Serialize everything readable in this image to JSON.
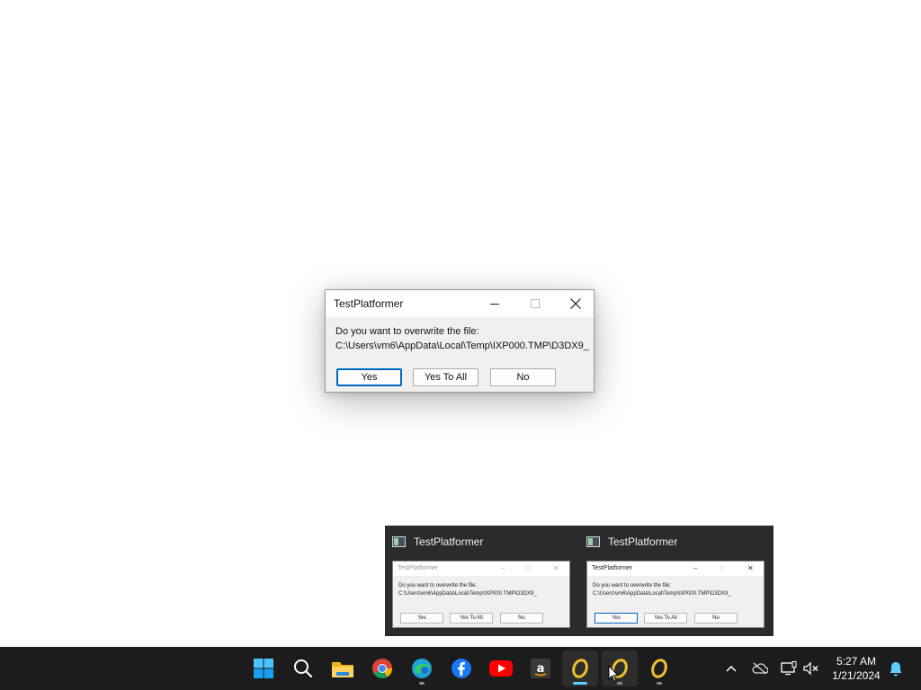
{
  "dialog": {
    "title": "TestPlatformer",
    "message_line1": "Do you want to overwrite the file:",
    "message_line2": "C:\\Users\\vm6\\AppData\\Local\\Temp\\IXP000.TMP\\D3DX9_",
    "buttons": {
      "yes": "Yes",
      "yes_to_all": "Yes To All",
      "no": "No"
    },
    "default_button": "yes"
  },
  "thumbnails": [
    {
      "title": "TestPlatformer",
      "dialog_title": "TestPlatformer",
      "message_line1": "Do you want to overwrite the file:",
      "message_line2": "C:\\Users\\vm6\\AppData\\Local\\Temp\\IXP000.TMP\\D3DX9_",
      "buttons": [
        "Yes",
        "Yes To All",
        "No"
      ]
    },
    {
      "title": "TestPlatformer",
      "dialog_title": "TestPlatformer",
      "message_line1": "Do you want to overwrite the file:",
      "message_line2": "C:\\Users\\vm6\\AppData\\Local\\Temp\\IXP000.TMP\\D3DX9_",
      "buttons": [
        "Yes",
        "Yes To All",
        "No"
      ]
    }
  ],
  "taskbar": {
    "pinned": [
      "windows-start-icon",
      "search-icon",
      "file-explorer-icon",
      "chrome-icon",
      "edge-icon",
      "facebook-icon",
      "youtube-icon",
      "amazon-icon",
      "testplatformer-icon",
      "testplatformer-icon",
      "testplatformer-icon"
    ],
    "tray": [
      "chevron-up-icon",
      "onedrive-offline-icon",
      "network-icon",
      "volume-muted-icon",
      "notification-bell-icon"
    ],
    "clock_time": "5:27 AM",
    "clock_date": "1/21/2024"
  },
  "colors": {
    "accent": "#0067c0",
    "taskbar_bg": "#1c1c1c",
    "active_indicator": "#60cdff",
    "dialog_bg": "#f0f0f0"
  }
}
